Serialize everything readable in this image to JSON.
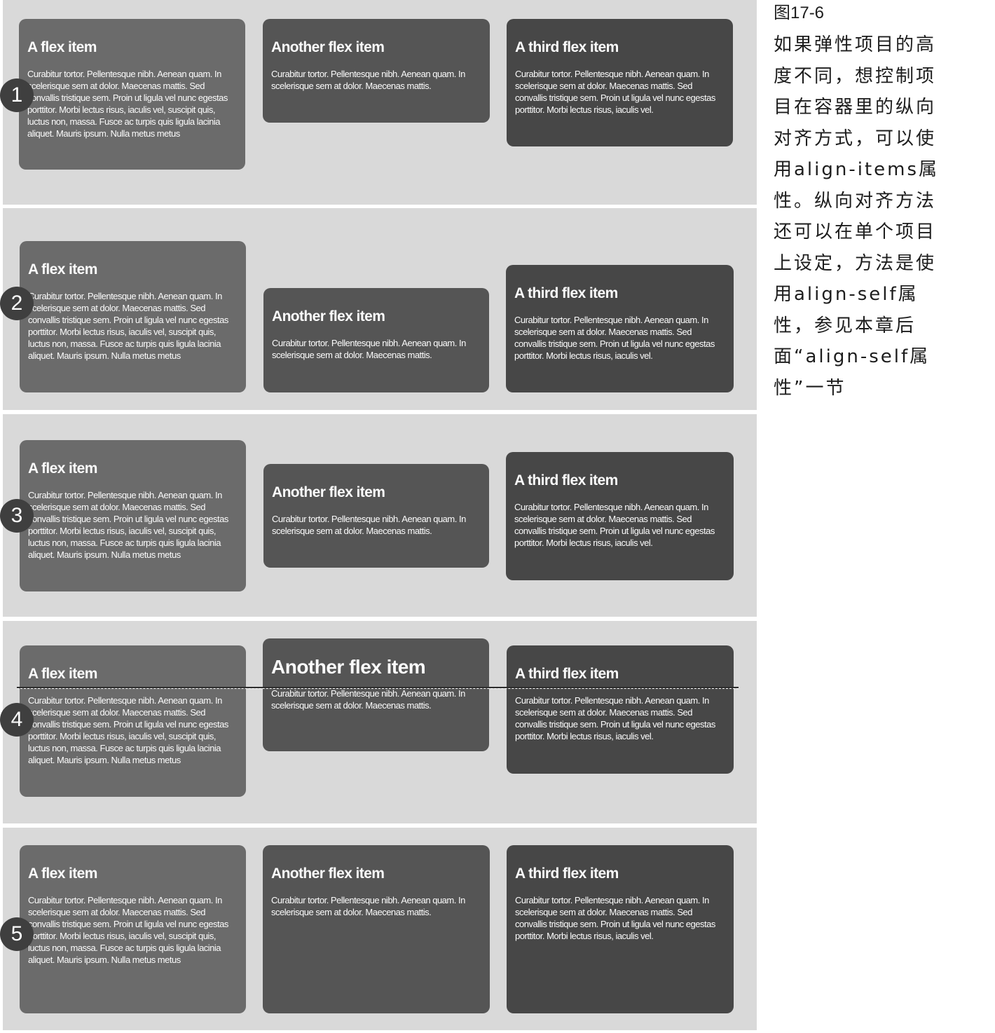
{
  "figure": {
    "item1_title": "A flex item",
    "item2_title": "Another flex item",
    "item3_title": "A third flex item",
    "item1_text": "Curabitur tortor. Pellentesque nibh. Aenean quam. In scelerisque sem at dolor. Maecenas mattis. Sed convallis tristique sem. Proin ut ligula vel nunc egestas porttitor. Morbi lectus risus, iaculis vel, suscipit quis, luctus non, massa. Fusce ac turpis quis ligula lacinia aliquet. Mauris ipsum. Nulla metus metus",
    "item2_text": "Curabitur tortor. Pellentesque nibh. Aenean quam. In scelerisque sem at dolor. Maecenas mattis.",
    "item3_text": "Curabitur tortor. Pellentesque nibh. Aenean quam. In scelerisque sem at dolor. Maecenas mattis. Sed convallis tristique sem. Proin ut ligula vel nunc egestas porttitor. Morbi lectus risus, iaculis vel.",
    "markers": [
      "1",
      "2",
      "3",
      "4",
      "5"
    ]
  },
  "caption": {
    "figure_label": "图17-6",
    "body": "如果弹性项目的高度不同，想控制项目在容器里的纵向对齐方式，可以使用align-items属性。纵向对齐方法还可以在单个项目上设定，方法是使用align-self属性，参见本章后面“align-self属性”一节"
  },
  "colors": {
    "row_background": "#d9d9d9",
    "item1": "#6b6b6b",
    "item2": "#555555",
    "item3": "#474747",
    "marker": "#3f3f3f"
  }
}
